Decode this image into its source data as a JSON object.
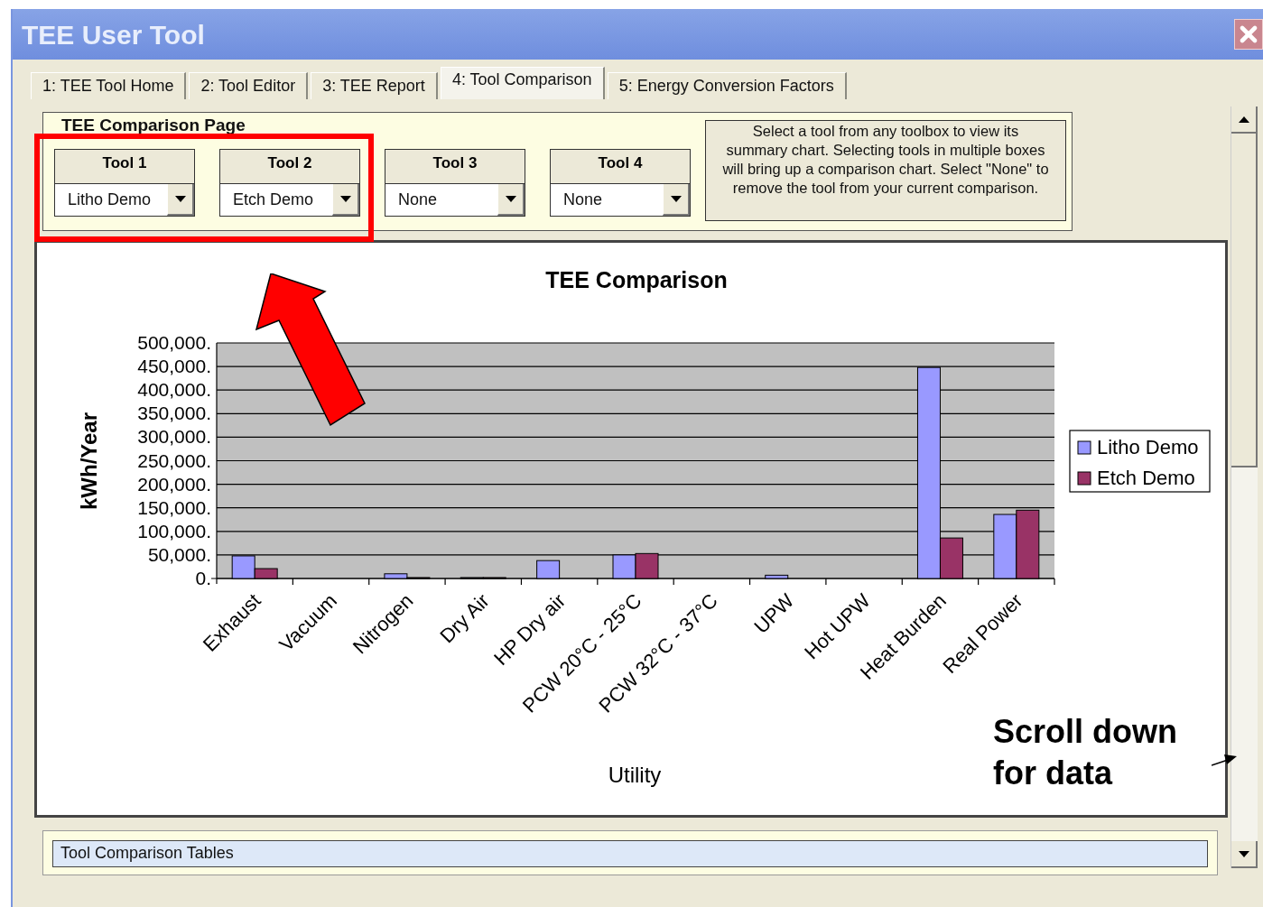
{
  "window": {
    "title": "TEE User Tool"
  },
  "tabs": [
    {
      "label": "1: TEE Tool Home",
      "selected": false
    },
    {
      "label": "2: Tool Editor",
      "selected": false
    },
    {
      "label": "3: TEE Report",
      "selected": false
    },
    {
      "label": "4: Tool Comparison",
      "selected": true
    },
    {
      "label": "5: Energy Conversion Factors",
      "selected": false
    }
  ],
  "comparison_page": {
    "title": "TEE Comparison Page",
    "tool_selectors": [
      {
        "label": "Tool 1",
        "value": "Litho Demo"
      },
      {
        "label": "Tool 2",
        "value": "Etch Demo"
      },
      {
        "label": "Tool 3",
        "value": "None"
      },
      {
        "label": "Tool 4",
        "value": "None"
      }
    ],
    "help_text": "Select a tool from any toolbox to view its summary chart.  Selecting tools in multiple boxes will bring up a comparison chart.  Select \"None\" to remove the tool from your current comparison."
  },
  "chart_panel": {
    "chart_data": {
      "type": "bar",
      "title": "TEE Comparison",
      "xlabel": "Utility",
      "ylabel": "kWh/Year",
      "categories": [
        "Exhaust",
        "Vacuum",
        "Nitrogen",
        "Dry Air",
        "HP Dry air",
        "PCW 20°C - 25°C",
        "PCW 32°C - 37°C",
        "UPW",
        "Hot UPW",
        "Heat Burden",
        "Real Power"
      ],
      "series": [
        {
          "name": "Litho Demo",
          "color": "#9999ff",
          "values": [
            48000,
            0,
            10000,
            2000,
            38000,
            50000,
            0,
            7000,
            0,
            448000,
            136000
          ]
        },
        {
          "name": "Etch Demo",
          "color": "#993366",
          "values": [
            21000,
            0,
            2000,
            2000,
            0,
            53000,
            0,
            0,
            0,
            86000,
            145000
          ]
        }
      ],
      "ylim": [
        0,
        500000
      ],
      "grid": true,
      "legend": true,
      "yticks": [
        {
          "value": 0,
          "label": "0."
        },
        {
          "value": 50000,
          "label": "50,000."
        },
        {
          "value": 100000,
          "label": "100,000."
        },
        {
          "value": 150000,
          "label": "150,000."
        },
        {
          "value": 200000,
          "label": "200,000."
        },
        {
          "value": 250000,
          "label": "250,000."
        },
        {
          "value": 300000,
          "label": "300,000."
        },
        {
          "value": 350000,
          "label": "350,000."
        },
        {
          "value": 400000,
          "label": "400,000."
        },
        {
          "value": 450000,
          "label": "450,000."
        },
        {
          "value": 500000,
          "label": "500,000."
        }
      ]
    }
  },
  "tables_panel": {
    "title": "Tool Comparison Tables"
  },
  "callout": {
    "text": "Scroll down for data"
  }
}
